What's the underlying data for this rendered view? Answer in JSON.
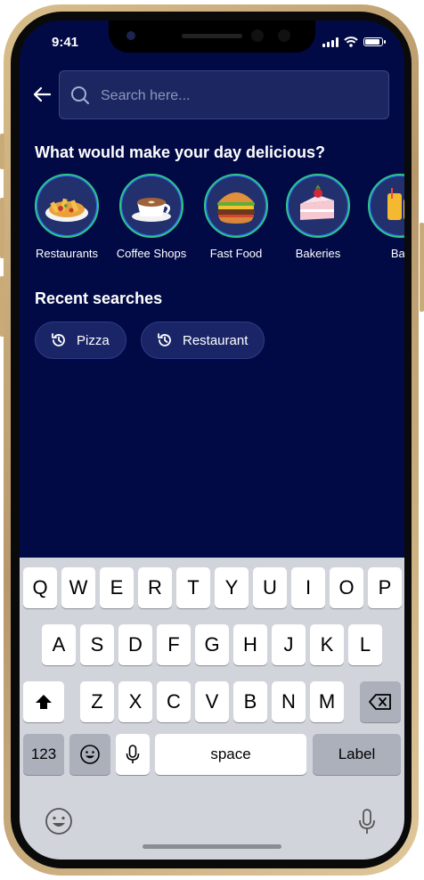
{
  "status": {
    "time": "9:41"
  },
  "search": {
    "placeholder": "Search here..."
  },
  "headings": {
    "categories": "What would make your day delicious?",
    "recent": "Recent searches"
  },
  "categories": [
    {
      "label": "Restaurants",
      "icon": "loaded-fries-icon"
    },
    {
      "label": "Coffee Shops",
      "icon": "coffee-cup-icon"
    },
    {
      "label": "Fast Food",
      "icon": "burger-icon"
    },
    {
      "label": "Bakeries",
      "icon": "cake-slice-icon"
    },
    {
      "label": "Bar",
      "icon": "drink-icon"
    }
  ],
  "recent_searches": [
    {
      "label": "Pizza",
      "icon": "history-icon"
    },
    {
      "label": "Restaurant",
      "icon": "history-icon"
    }
  ],
  "keyboard": {
    "row1": [
      "Q",
      "W",
      "E",
      "R",
      "T",
      "Y",
      "U",
      "I",
      "O",
      "P"
    ],
    "row2": [
      "A",
      "S",
      "D",
      "F",
      "G",
      "H",
      "J",
      "K",
      "L"
    ],
    "row3": [
      "Z",
      "X",
      "C",
      "V",
      "B",
      "N",
      "M"
    ],
    "numbers_key": "123",
    "space_key": "space",
    "return_key": "Label"
  },
  "colors": {
    "background": "#020a45",
    "accent_ring": "#2fc58a",
    "chip": "#1a2568"
  }
}
